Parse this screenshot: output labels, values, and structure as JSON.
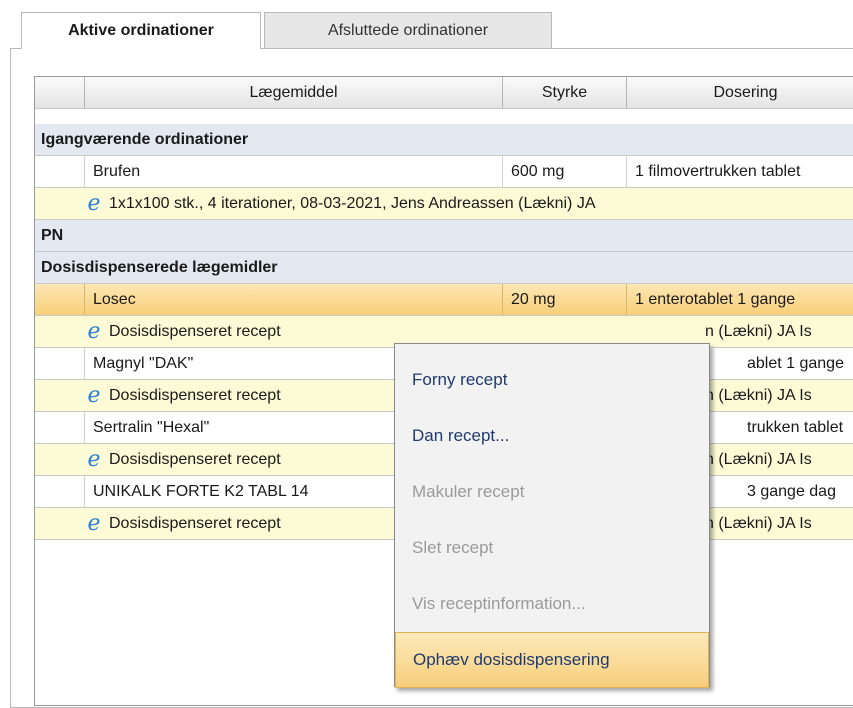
{
  "tabs": [
    {
      "label": "Aktive ordinationer",
      "active": true
    },
    {
      "label": "Afsluttede ordinationer",
      "active": false
    }
  ],
  "table": {
    "headers": [
      "",
      "Lægemiddel",
      "Styrke",
      "Dosering"
    ],
    "rows": [
      {
        "type": "group",
        "label": "Igangværende ordinationer"
      },
      {
        "type": "drug",
        "name": "Brufen",
        "strength": "600 mg",
        "dosage": "1 filmovertrukken tablet"
      },
      {
        "type": "recipe",
        "text": "1x1x100 stk., 4 iterationer, 08-03-2021, Jens Andreassen (Lækni) JA"
      },
      {
        "type": "group",
        "label": "PN"
      },
      {
        "type": "group",
        "label": "Dosisdispenserede lægemidler"
      },
      {
        "type": "drug",
        "selected": true,
        "name": "Losec",
        "strength": "20 mg",
        "dosage": "1 enterotablet 1 gange"
      },
      {
        "type": "recipe",
        "text": "Dosisdispenseret recept",
        "tail": "n (Lækni) JA Is"
      },
      {
        "type": "drug",
        "name": "Magnyl \"DAK\"",
        "strength": "",
        "dosage": "ablet 1 gange"
      },
      {
        "type": "recipe",
        "text": "Dosisdispenseret recept",
        "tail": "n (Lækni) JA Is"
      },
      {
        "type": "drug",
        "name": "Sertralin \"Hexal\"",
        "strength": "",
        "dosage": "trukken tablet"
      },
      {
        "type": "recipe",
        "text": "Dosisdispenseret recept",
        "tail": "n (Lækni) JA Is"
      },
      {
        "type": "drug",
        "name": "UNIKALK FORTE K2 TABL 14",
        "strength": "",
        "dosage": "3 gange dag"
      },
      {
        "type": "recipe",
        "text": "Dosisdispenseret recept",
        "tail": "n (Lækni) JA Is"
      }
    ]
  },
  "context_menu": {
    "items": [
      {
        "label": "Forny recept",
        "enabled": true
      },
      {
        "label": "Dan recept...",
        "enabled": true
      },
      {
        "label": "Makuler  recept",
        "enabled": false
      },
      {
        "label": "Slet recept",
        "enabled": false
      },
      {
        "label": "Vis receptinformation...",
        "enabled": false
      },
      {
        "label": "Ophæv dosisdispensering",
        "enabled": true,
        "highlighted": true
      }
    ]
  },
  "colors": {
    "selected_row": "#f8cf7a",
    "recipe_row": "#fdfad6",
    "group_row": "#e4e8f0",
    "menu_text": "#1f3a6e",
    "ie_icon": "#2a7fd4"
  },
  "icons": {
    "recipe": "e-recipe-icon"
  }
}
